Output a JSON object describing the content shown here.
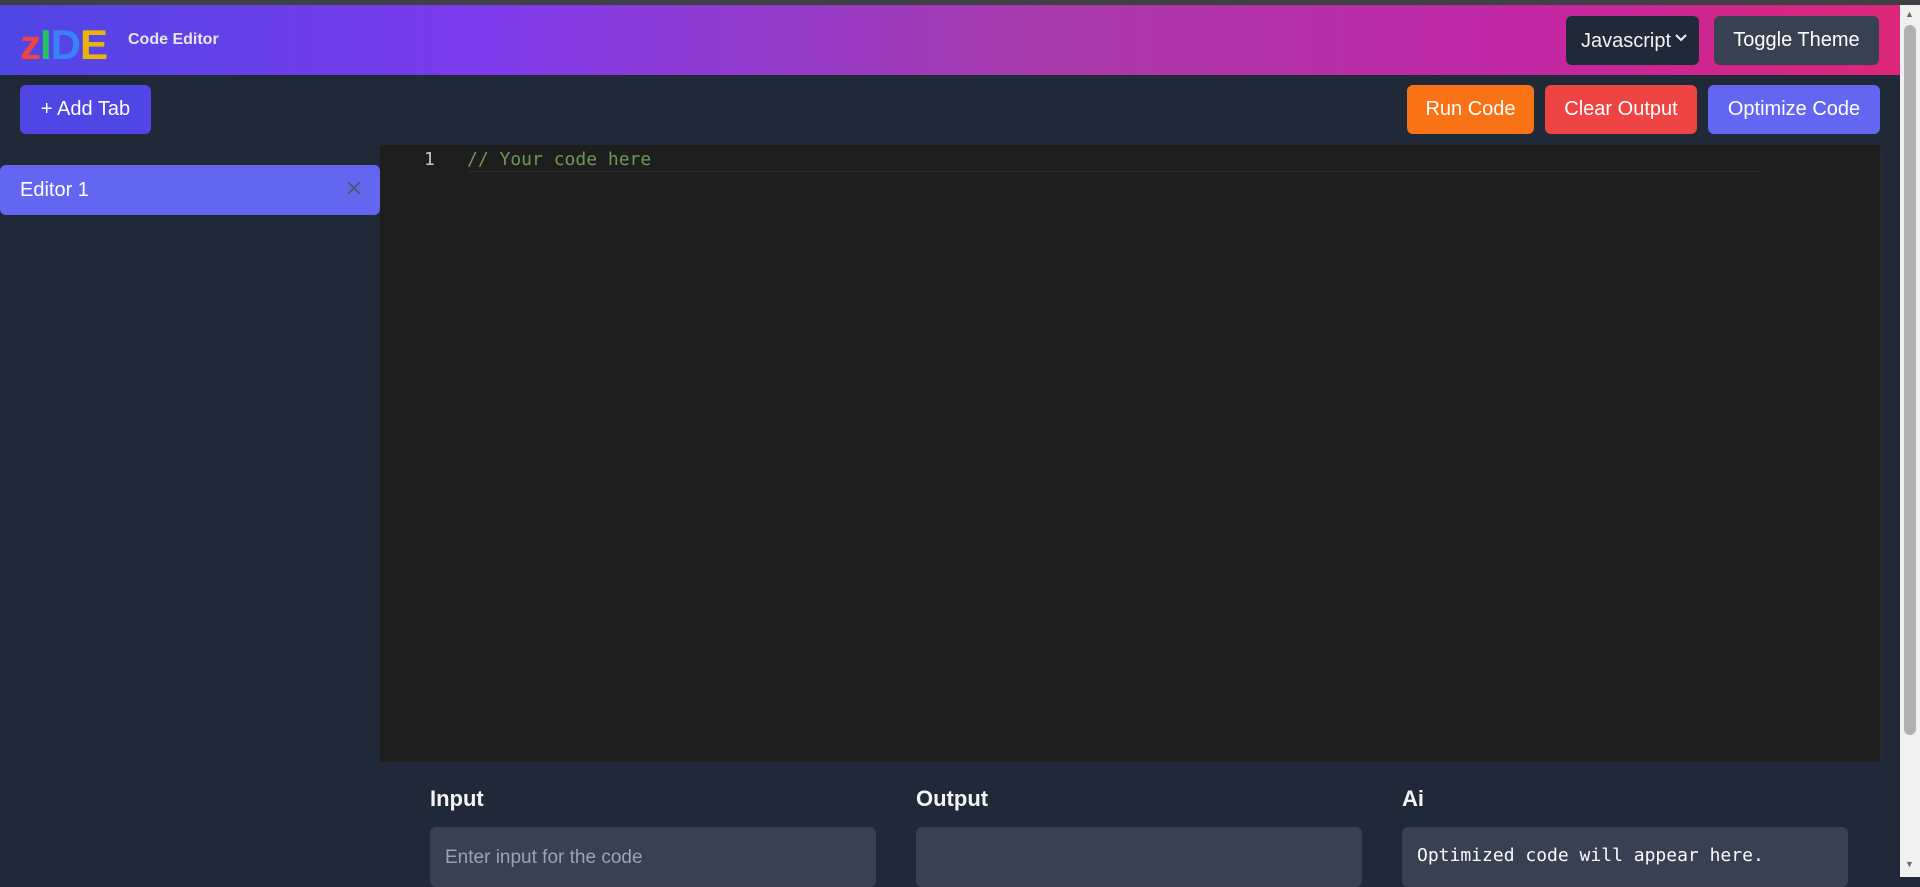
{
  "header": {
    "logo": {
      "letters": [
        {
          "char": "z",
          "color": "#ef4444"
        },
        {
          "char": "I",
          "color": "#22c55e"
        },
        {
          "char": "D",
          "color": "#3b82f6"
        },
        {
          "char": "E",
          "color": "#eab308"
        }
      ],
      "subtitle": "Code Editor"
    },
    "language_select": {
      "value": "Javascript",
      "icon": "chevron-down-icon"
    },
    "toggle_theme_label": "Toggle Theme"
  },
  "toolbar": {
    "add_tab_label": "+ Add Tab",
    "run_label": "Run Code",
    "clear_label": "Clear Output",
    "optimize_label": "Optimize Code"
  },
  "sidebar": {
    "tabs": [
      {
        "label": "Editor 1",
        "active": true,
        "close_icon": "close-icon"
      }
    ]
  },
  "editor": {
    "lines": [
      {
        "number": "1",
        "text": "// Your code here"
      }
    ]
  },
  "panels": {
    "input": {
      "title": "Input",
      "placeholder": "Enter input for the code"
    },
    "output": {
      "title": "Output",
      "value": ""
    },
    "ai": {
      "title": "Ai",
      "value": "Optimized code will appear here."
    }
  },
  "colors": {
    "accent": "#6366f1",
    "run": "#f97316",
    "clear": "#ef4444",
    "add_tab": "#4f46e5"
  }
}
